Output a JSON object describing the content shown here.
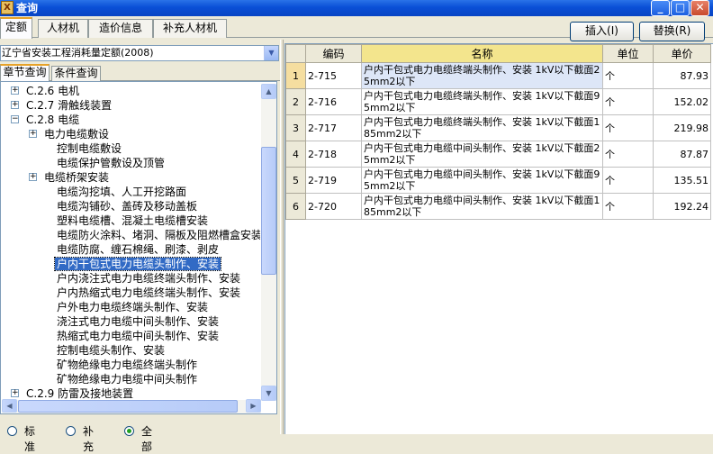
{
  "window": {
    "title": "查询",
    "icon_glyph": "X",
    "minimize_glyph": "_",
    "maximize_glyph": "□",
    "close_glyph": "✕"
  },
  "main_tabs": [
    {
      "label": "定额",
      "active": true
    },
    {
      "label": "人材机",
      "active": false
    },
    {
      "label": "造价信息",
      "active": false
    },
    {
      "label": "补充人材机",
      "active": false
    }
  ],
  "toolbar": {
    "insert_label": "插入(I)",
    "replace_label": "替换(R)"
  },
  "quota_library": {
    "selected": "辽宁省安装工程消耗量定额(2008)"
  },
  "sub_tabs": [
    {
      "label": "章节查询",
      "active": true
    },
    {
      "label": "条件查询",
      "active": false
    }
  ],
  "tree": [
    {
      "label": "C.2.6 电机",
      "level": 0,
      "expander": "+"
    },
    {
      "label": "C.2.7 滑触线装置",
      "level": 0,
      "expander": "+"
    },
    {
      "label": "C.2.8 电缆",
      "level": 0,
      "expander": "−"
    },
    {
      "label": "电力电缆敷设",
      "level": 1,
      "expander": "+"
    },
    {
      "label": "控制电缆敷设",
      "level": 1,
      "expander": ""
    },
    {
      "label": "电缆保护管敷设及顶管",
      "level": 1,
      "expander": ""
    },
    {
      "label": "电缆桥架安装",
      "level": 1,
      "expander": "+"
    },
    {
      "label": "电缆沟挖填、人工开挖路面",
      "level": 1,
      "expander": ""
    },
    {
      "label": "电缆沟铺砂、盖砖及移动盖板",
      "level": 1,
      "expander": ""
    },
    {
      "label": "塑料电缆槽、混凝土电缆槽安装",
      "level": 1,
      "expander": ""
    },
    {
      "label": "电缆防火涂料、堵洞、隔板及阻燃槽盒安装",
      "level": 1,
      "expander": ""
    },
    {
      "label": "电缆防腐、缠石棉绳、刷漆、剥皮",
      "level": 1,
      "expander": ""
    },
    {
      "label": "户内干包式电力电缆头制作、安装",
      "level": 1,
      "expander": "",
      "selected": true
    },
    {
      "label": "户内浇注式电力电缆终端头制作、安装",
      "level": 1,
      "expander": ""
    },
    {
      "label": "户内热缩式电力电缆终端头制作、安装",
      "level": 1,
      "expander": ""
    },
    {
      "label": "户外电力电缆终端头制作、安装",
      "level": 1,
      "expander": ""
    },
    {
      "label": "浇注式电力电缆中间头制作、安装",
      "level": 1,
      "expander": ""
    },
    {
      "label": "热缩式电力电缆中间头制作、安装",
      "level": 1,
      "expander": ""
    },
    {
      "label": "控制电缆头制作、安装",
      "level": 1,
      "expander": ""
    },
    {
      "label": "矿物绝缘电力电缆终端头制作",
      "level": 1,
      "expander": ""
    },
    {
      "label": "矿物绝缘电力电缆中间头制作",
      "level": 1,
      "expander": ""
    },
    {
      "label": "C.2.9 防雷及接地装置",
      "level": 0,
      "expander": "+"
    }
  ],
  "scroll": {
    "up_glyph": "▲",
    "down_glyph": "▼",
    "left_glyph": "◀",
    "right_glyph": "▶"
  },
  "filter_radios": [
    {
      "label": "标准",
      "checked": false
    },
    {
      "label": "补充",
      "checked": false
    },
    {
      "label": "全部",
      "checked": true
    }
  ],
  "grid": {
    "columns": [
      "",
      "编码",
      "名称",
      "单位",
      "单价"
    ],
    "rows": [
      {
        "num": "1",
        "code": "2-715",
        "name": "户内干包式电力电缆终端头制作、安装 1kV以下截面25mm2以下",
        "unit": "个",
        "price": "87.93",
        "selected": true
      },
      {
        "num": "2",
        "code": "2-716",
        "name": "户内干包式电力电缆终端头制作、安装 1kV以下截面95mm2以下",
        "unit": "个",
        "price": "152.02"
      },
      {
        "num": "3",
        "code": "2-717",
        "name": "户内干包式电力电缆终端头制作、安装 1kV以下截面185mm2以下",
        "unit": "个",
        "price": "219.98"
      },
      {
        "num": "4",
        "code": "2-718",
        "name": "户内干包式电力电缆中间头制作、安装 1kV以下截面25mm2以下",
        "unit": "个",
        "price": "87.87"
      },
      {
        "num": "5",
        "code": "2-719",
        "name": "户内干包式电力电缆中间头制作、安装 1kV以下截面95mm2以下",
        "unit": "个",
        "price": "135.51"
      },
      {
        "num": "6",
        "code": "2-720",
        "name": "户内干包式电力电缆中间头制作、安装 1kV以下截面185mm2以下",
        "unit": "个",
        "price": "192.24"
      }
    ]
  }
}
